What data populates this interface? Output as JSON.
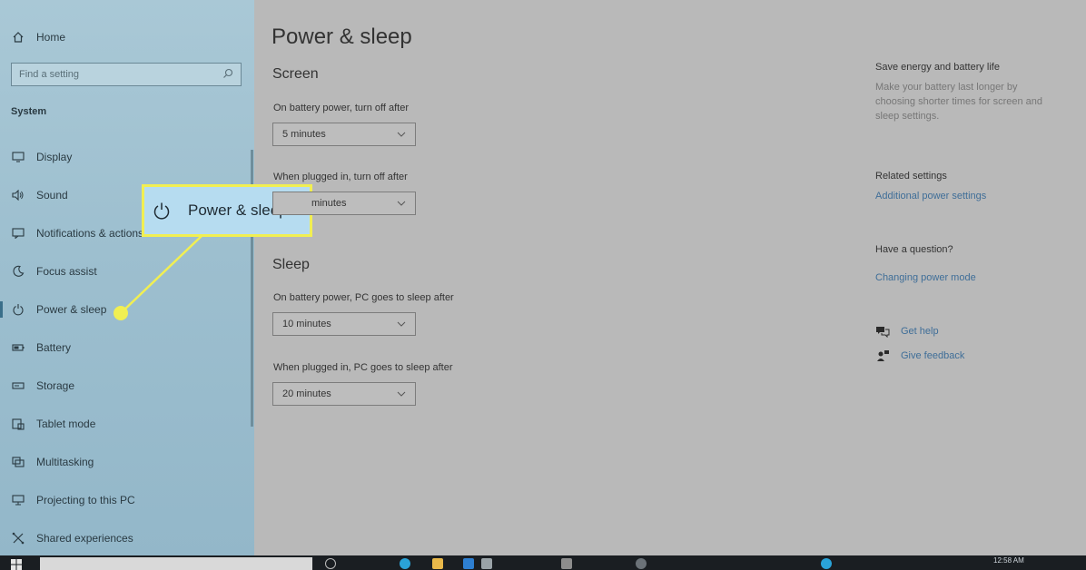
{
  "sidebar": {
    "home_label": "Home",
    "search_placeholder": "Find a setting",
    "section_label": "System",
    "items": [
      {
        "label": "Display",
        "icon": "display-icon"
      },
      {
        "label": "Sound",
        "icon": "speaker-icon"
      },
      {
        "label": "Notifications & actions",
        "icon": "notifications-icon"
      },
      {
        "label": "Focus assist",
        "icon": "moon-icon"
      },
      {
        "label": "Power & sleep",
        "icon": "power-icon"
      },
      {
        "label": "Battery",
        "icon": "battery-icon"
      },
      {
        "label": "Storage",
        "icon": "storage-icon"
      },
      {
        "label": "Tablet mode",
        "icon": "tablet-icon"
      },
      {
        "label": "Multitasking",
        "icon": "multitasking-icon"
      },
      {
        "label": "Projecting to this PC",
        "icon": "projector-icon"
      },
      {
        "label": "Shared experiences",
        "icon": "shared-icon"
      }
    ]
  },
  "callout": {
    "label": "Power & sleep",
    "icon": "power-icon",
    "border_color": "#f1ef52",
    "fill_color": "#b6dcf0"
  },
  "main": {
    "title": "Power & sleep",
    "screen": {
      "heading": "Screen",
      "battery_label": "On battery power, turn off after",
      "battery_value": "5 minutes",
      "plugged_label": "When plugged in, turn off after",
      "plugged_value": "minutes"
    },
    "sleep": {
      "heading": "Sleep",
      "battery_label": "On battery power, PC goes to sleep after",
      "battery_value": "10 minutes",
      "plugged_label": "When plugged in, PC goes to sleep after",
      "plugged_value": "20 minutes"
    }
  },
  "right": {
    "save_energy_heading": "Save energy and battery life",
    "save_energy_text": "Make your battery last longer by choosing shorter times for screen and sleep settings.",
    "related_heading": "Related settings",
    "related_link": "Additional power settings",
    "question_heading": "Have a question?",
    "question_link": "Changing power mode",
    "get_help": "Get help",
    "give_feedback": "Give feedback"
  },
  "taskbar": {
    "time": "12:58 AM"
  },
  "colors": {
    "link": "#3f6e98",
    "accent": "#f1ef52",
    "sidebar": "#a9c8d6",
    "taskbar": "#1a1e22"
  }
}
